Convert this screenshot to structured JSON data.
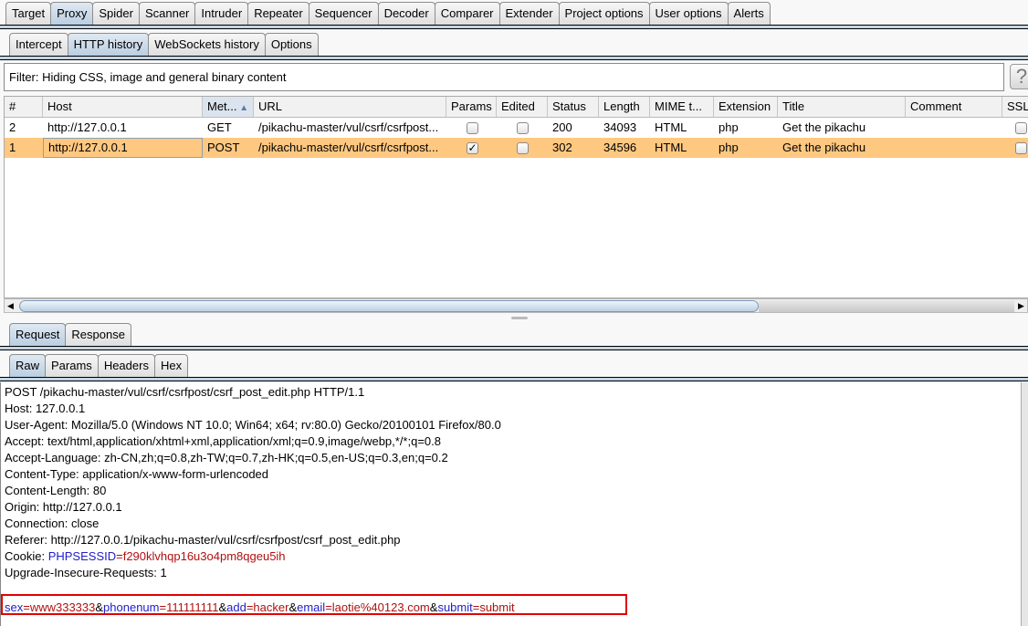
{
  "top_tabs": [
    "Target",
    "Proxy",
    "Spider",
    "Scanner",
    "Intruder",
    "Repeater",
    "Sequencer",
    "Decoder",
    "Comparer",
    "Extender",
    "Project options",
    "User options",
    "Alerts"
  ],
  "top_selected": 1,
  "proxy_tabs": [
    "Intercept",
    "HTTP history",
    "WebSockets history",
    "Options"
  ],
  "proxy_selected": 1,
  "filter": "Filter: Hiding CSS, image and general binary content",
  "help_label": "?",
  "table": {
    "columns": [
      "#",
      "Host",
      "Met...",
      "URL",
      "Params",
      "Edited",
      "Status",
      "Length",
      "MIME t...",
      "Extension",
      "Title",
      "Comment",
      "SSL"
    ],
    "sorted_column": "Met...",
    "sort_icon": "sort-ascending-icon",
    "rows": [
      {
        "num": "2",
        "host": "http://127.0.0.1",
        "method": "GET",
        "url": "/pikachu-master/vul/csrf/csrfpost...",
        "params": false,
        "edited": false,
        "status": "200",
        "length": "34093",
        "mime": "HTML",
        "ext": "php",
        "title": "Get the pikachu",
        "comment": "",
        "ssl": false,
        "selected": false
      },
      {
        "num": "1",
        "host": "http://127.0.0.1",
        "method": "POST",
        "url": "/pikachu-master/vul/csrf/csrfpost...",
        "params": true,
        "edited": false,
        "status": "302",
        "length": "34596",
        "mime": "HTML",
        "ext": "php",
        "title": "Get the pikachu",
        "comment": "",
        "ssl": false,
        "selected": true
      }
    ]
  },
  "msg_tabs": [
    "Request",
    "Response"
  ],
  "msg_selected": 0,
  "view_tabs": [
    "Raw",
    "Params",
    "Headers",
    "Hex"
  ],
  "view_selected": 0,
  "request": {
    "lines": [
      "POST /pikachu-master/vul/csrf/csrfpost/csrf_post_edit.php HTTP/1.1",
      "Host: 127.0.0.1",
      "User-Agent: Mozilla/5.0 (Windows NT 10.0; Win64; x64; rv:80.0) Gecko/20100101 Firefox/80.0",
      "Accept: text/html,application/xhtml+xml,application/xml;q=0.9,image/webp,*/*;q=0.8",
      "Accept-Language: zh-CN,zh;q=0.8,zh-TW;q=0.7,zh-HK;q=0.5,en-US;q=0.3,en;q=0.2",
      "Content-Type: application/x-www-form-urlencoded",
      "Content-Length: 80",
      "Origin: http://127.0.0.1",
      "Connection: close",
      "Referer: http://127.0.0.1/pikachu-master/vul/csrf/csrfpost/csrf_post_edit.php"
    ],
    "cookie": {
      "label": "Cookie: ",
      "name": "PHPSESSID",
      "value": "f290klvhqp16u3o4pm8qgeu5ih"
    },
    "after_cookie": "Upgrade-Insecure-Requests: 1",
    "body": [
      {
        "name": "sex",
        "value": "www333333"
      },
      {
        "name": "phonenum",
        "value": "111111111"
      },
      {
        "name": "add",
        "value": "hacker"
      },
      {
        "name": "email",
        "value": "laotie%40123.com"
      },
      {
        "name": "submit",
        "value": "submit"
      }
    ]
  },
  "colors": {
    "selected_row": "#ffc880",
    "param_name": "#2020c8",
    "param_value": "#b01010",
    "highlight_box": "#e00000"
  }
}
